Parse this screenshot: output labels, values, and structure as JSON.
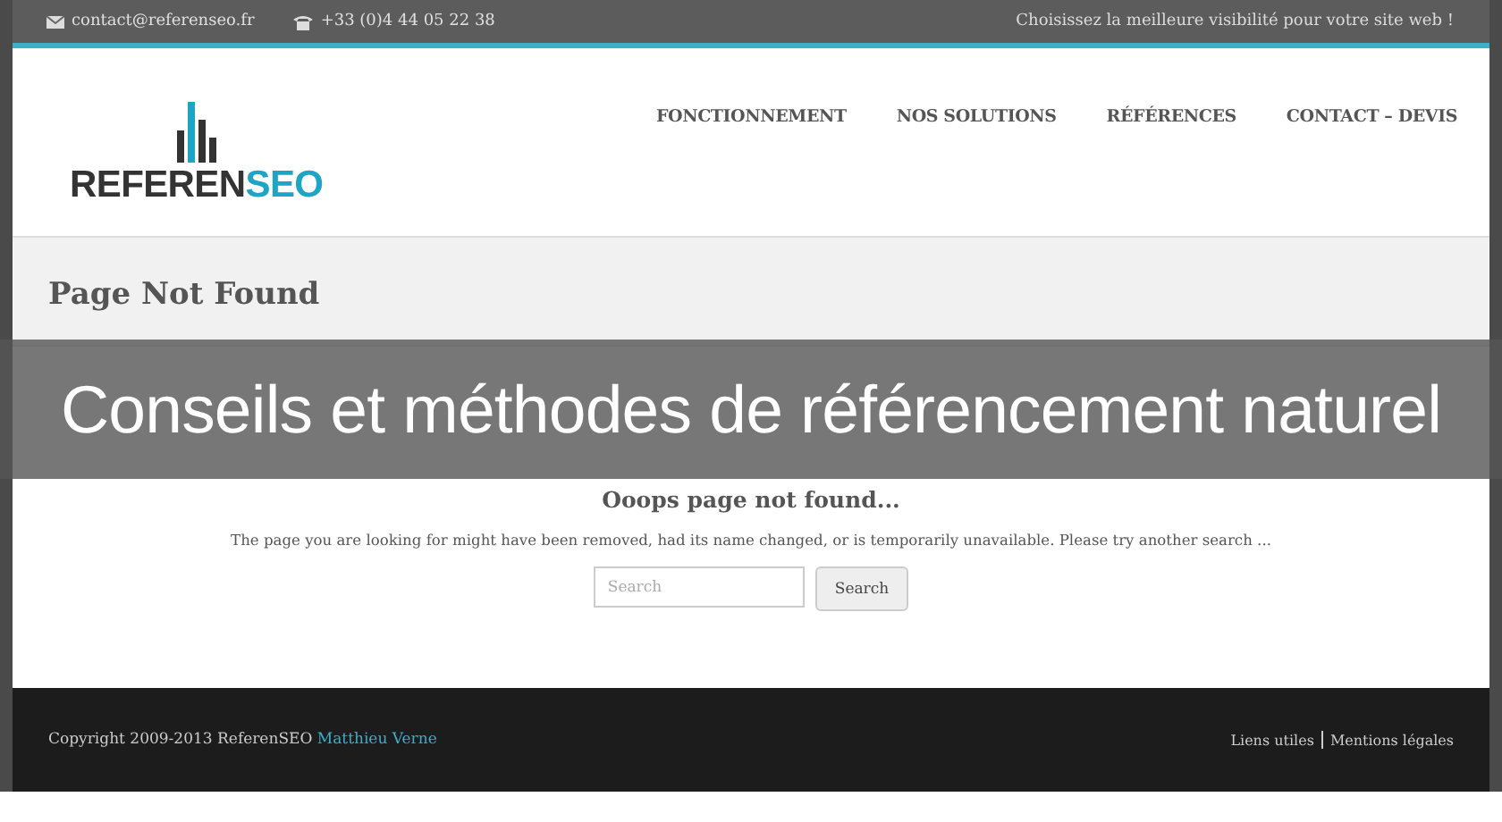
{
  "top_bar": {
    "email": "contact@referenseo.fr",
    "phone": "+33 (0)4 44 05 22 38",
    "tagline": "Choisissez la meilleure visibilité pour votre site web !"
  },
  "logo": {
    "parts": [
      "REFEREN",
      "SEO"
    ]
  },
  "nav": [
    "FONCTIONNEMENT",
    "NOS SOLUTIONS",
    "RÉFÉRENCES",
    "CONTACT – DEVIS"
  ],
  "page_title": "Page Not Found",
  "banner": "Conseils et méthodes de référencement naturel",
  "content": {
    "heading": "Ooops page not found...",
    "message": "The page you are looking for might have been removed, had its name changed, or is temporarily unavailable. Please try another search ...",
    "search": {
      "placeholder": "Search",
      "button": "Search"
    }
  },
  "footer": {
    "copyright": "Copyright 2009-2013 ReferenSEO",
    "author": "Matthieu Verne",
    "links": [
      "Liens utiles",
      "Mentions légales"
    ]
  }
}
